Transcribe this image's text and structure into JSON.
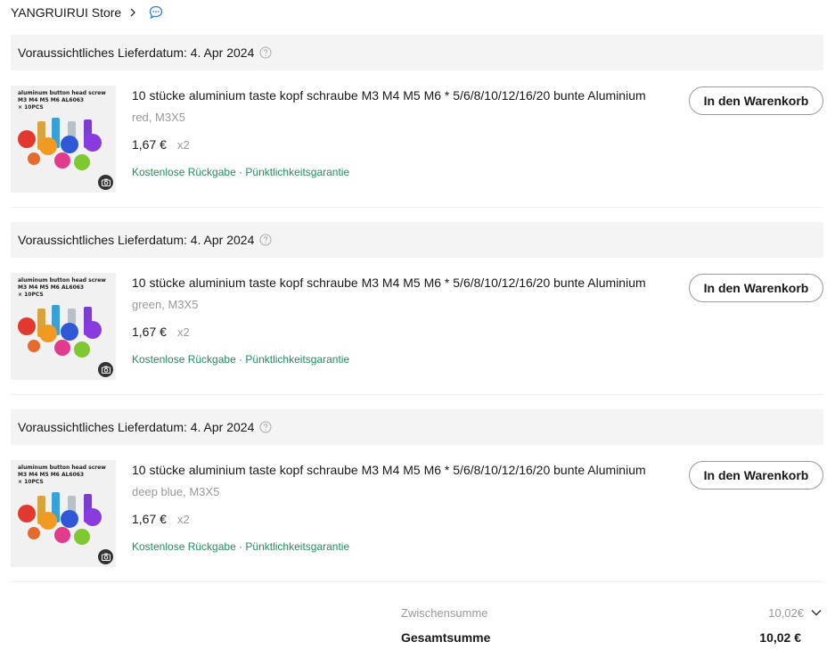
{
  "store": {
    "name": "YANGRUIRUI Store"
  },
  "groups": [
    {
      "delivery": "Voraussichtliches Lieferdatum: 4. Apr 2024",
      "item": {
        "title": "10 stücke aluminium taste kopf schraube M3 M4 M5 M6 * 5/6/8/10/12/16/20 bunte Aluminium",
        "variant": "red, M3X5",
        "price": "1,67 €",
        "qty": "x2",
        "guarantee": "Kostenlose Rückgabe · Pünktlichkeitsgarantie",
        "cart_label": "In den Warenkorb",
        "thumb_text": [
          "aluminum button head screw",
          "M3 M4 M5 M6      AL6063",
          "× 10PCS"
        ]
      }
    },
    {
      "delivery": "Voraussichtliches Lieferdatum: 4. Apr 2024",
      "item": {
        "title": "10 stücke aluminium taste kopf schraube M3 M4 M5 M6 * 5/6/8/10/12/16/20 bunte Aluminium",
        "variant": "green, M3X5",
        "price": "1,67 €",
        "qty": "x2",
        "guarantee": "Kostenlose Rückgabe · Pünktlichkeitsgarantie",
        "cart_label": "In den Warenkorb",
        "thumb_text": [
          "aluminum button head screw",
          "M3 M4 M5 M6      AL6063",
          "× 10PCS"
        ]
      }
    },
    {
      "delivery": "Voraussichtliches Lieferdatum: 4. Apr 2024",
      "item": {
        "title": "10 stücke aluminium taste kopf schraube M3 M4 M5 M6 * 5/6/8/10/12/16/20 bunte Aluminium",
        "variant": "deep blue, M3X5",
        "price": "1,67 €",
        "qty": "x2",
        "guarantee": "Kostenlose Rückgabe · Pünktlichkeitsgarantie",
        "cart_label": "In den Warenkorb",
        "thumb_text": [
          "aluminum button head screw",
          "M3 M4 M5 M6      AL6063",
          "× 10PCS"
        ]
      }
    }
  ],
  "summary": {
    "subtotal_label": "Zwischensumme",
    "subtotal_value": "10,02€",
    "total_label": "Gesamtsumme",
    "total_value": "10,02 €"
  },
  "colors": {
    "guarantee": "#1f8f5a",
    "header_bg": "#f4f4f4",
    "muted": "#999999"
  },
  "icons": {
    "store_arrow": "chevron-right-icon",
    "chat": "chat-bubble-icon",
    "help": "question-circle-icon",
    "camera": "camera-icon",
    "expand": "chevron-down-icon"
  }
}
